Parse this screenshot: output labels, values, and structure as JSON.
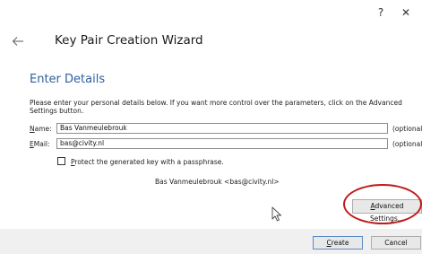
{
  "window": {
    "help_glyph": "?",
    "close_glyph": "✕"
  },
  "header": {
    "title": "Key Pair Creation Wizard"
  },
  "section": {
    "heading": "Enter Details",
    "intro": "Please enter your personal details below. If you want more control over the parameters, click on the Advanced Settings button."
  },
  "form": {
    "name": {
      "label_hotkey": "N",
      "label_rest": "ame:",
      "value": "Bas Vanmeulebrouk",
      "optional": "(optional)"
    },
    "email": {
      "label_hotkey": "E",
      "label_rest": "Mail:",
      "value": "bas@civity.nl",
      "optional": "(optional)"
    },
    "passphrase": {
      "label_hotkey": "P",
      "label_rest": "rotect the generated key with a passphrase.",
      "checked": false
    },
    "identity_preview": "Bas Vanmeulebrouk <bas@civity.nl>"
  },
  "buttons": {
    "advanced_hotkey": "A",
    "advanced_rest": "dvanced Settings...",
    "create_hotkey": "C",
    "create_rest": "reate",
    "cancel_label": "Cancel"
  },
  "icons": {
    "back": "back-arrow-icon",
    "help": "help-icon",
    "close": "close-icon",
    "cursor": "mouse-pointer-icon"
  },
  "colors": {
    "heading": "#2f5e9e",
    "highlight": "#c11a1a",
    "footer_bg": "#f0f0f0",
    "default_button_border": "#5a8bc6"
  }
}
